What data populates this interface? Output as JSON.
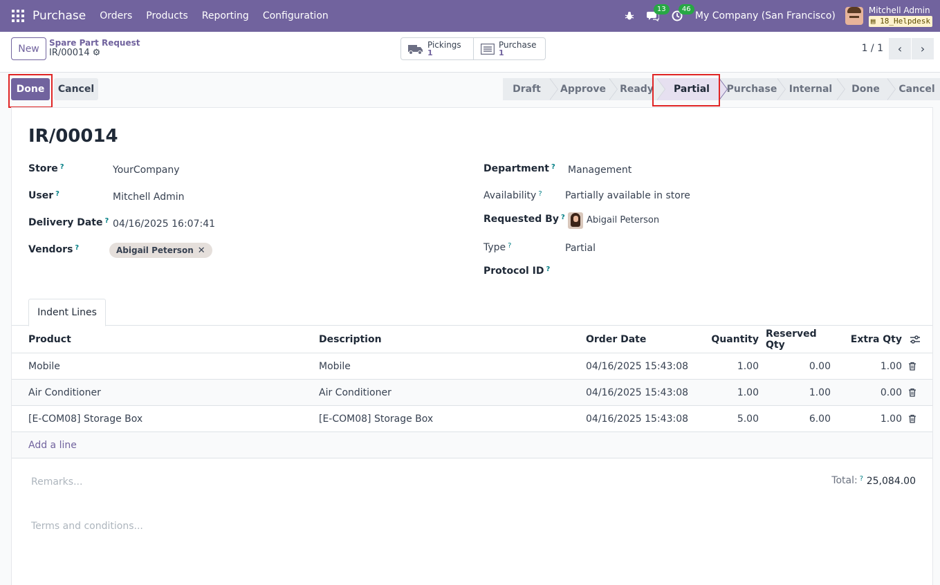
{
  "navbar": {
    "app_name": "Purchase",
    "menu": [
      "Orders",
      "Products",
      "Reporting",
      "Configuration"
    ],
    "chat_count": "13",
    "activity_count": "46",
    "company": "My Company (San Francisco)",
    "user_name": "Mitchell Admin",
    "database": "18_Helpdesk"
  },
  "control": {
    "new_label": "New",
    "breadcrumb_parent": "Spare Part Request",
    "breadcrumb_current": "IR/00014",
    "smart_buttons": [
      {
        "label": "Pickings",
        "value": "1",
        "icon": "truck-icon"
      },
      {
        "label": "Purchase",
        "value": "1",
        "icon": "list-icon"
      }
    ],
    "pager": "1 / 1"
  },
  "statusbar": {
    "done_label": "Done",
    "cancel_label": "Cancel",
    "stages": [
      "Draft",
      "Approve",
      "Ready",
      "Partial",
      "Purchase",
      "Internal",
      "Done",
      "Cancel"
    ],
    "active_stage": "Partial"
  },
  "form": {
    "title": "IR/00014",
    "left": [
      {
        "label": "Store",
        "value": "YourCompany"
      },
      {
        "label": "User",
        "value": "Mitchell Admin"
      },
      {
        "label": "Delivery Date",
        "value": "04/16/2025 16:07:41"
      },
      {
        "label": "Vendors",
        "value": "Abigail Peterson"
      }
    ],
    "right": [
      {
        "label": "Department",
        "value": "Management"
      },
      {
        "label": "Availability",
        "value": "Partially available in store"
      },
      {
        "label": "Requested By",
        "value": "Abigail Peterson"
      },
      {
        "label": "Type",
        "value": "Partial"
      },
      {
        "label": "Protocol ID",
        "value": ""
      }
    ]
  },
  "tabs": [
    "Indent Lines"
  ],
  "table": {
    "columns": [
      "Product",
      "Description",
      "Order Date",
      "Quantity",
      "Reserved Qty",
      "Extra Qty"
    ],
    "rows": [
      {
        "product": "Mobile",
        "description": "Mobile",
        "date": "04/16/2025 15:43:08",
        "qty": "1.00",
        "reserved": "0.00",
        "extra": "1.00"
      },
      {
        "product": "Air Conditioner",
        "description": "Air Conditioner",
        "date": "04/16/2025 15:43:08",
        "qty": "1.00",
        "reserved": "1.00",
        "extra": "0.00"
      },
      {
        "product": "[E-COM08] Storage Box",
        "description": "[E-COM08] Storage Box",
        "date": "04/16/2025 15:43:08",
        "qty": "5.00",
        "reserved": "6.00",
        "extra": "1.00"
      }
    ],
    "add_line": "Add a line"
  },
  "footer": {
    "remarks_placeholder": "Remarks...",
    "total_label": "Total:",
    "total_value": "25,084.00",
    "terms_placeholder": "Terms and conditions..."
  },
  "colors": {
    "brand": "#71639e",
    "badge": "#28a745",
    "highlight": "#e02424"
  }
}
